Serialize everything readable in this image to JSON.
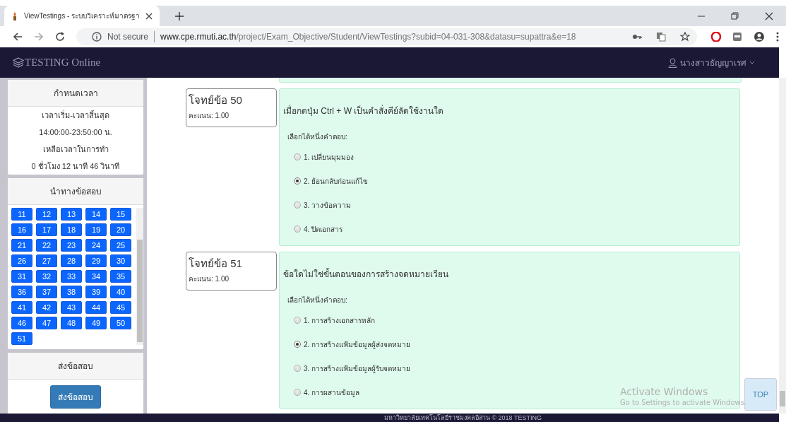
{
  "browser": {
    "tab_title": "ViewTestings - ระบบวิเคราะห์มาตรฐา",
    "security": "Not secure",
    "url_host": "www.cpe.rmuti.ac.th",
    "url_path": "/project/Exam_Objective/Student/ViewTestings?subid=04-031-308&datasu=supattra&e=18"
  },
  "navbar": {
    "brand": "TESTING Online",
    "user": "นางสาวธัญญาเรศ"
  },
  "sidebar": {
    "time_panel": {
      "title": "กำหนดเวลา",
      "lines": [
        "เวลาเริ่ม-เวลาสิ้นสุด",
        "14:00:00-23:50:00 น.",
        "เหลือเวลาในการทำ",
        "0 ชั่วโมง 12 นาที 46 วินาที"
      ]
    },
    "nav_panel": {
      "title": "นำทางข้อสอบ",
      "buttons": [
        "11",
        "12",
        "13",
        "14",
        "15",
        "16",
        "17",
        "18",
        "19",
        "20",
        "21",
        "22",
        "23",
        "24",
        "25",
        "26",
        "27",
        "28",
        "29",
        "30",
        "31",
        "32",
        "33",
        "34",
        "35",
        "36",
        "37",
        "38",
        "39",
        "40",
        "41",
        "42",
        "43",
        "44",
        "45",
        "46",
        "47",
        "48",
        "49",
        "50",
        "51"
      ]
    },
    "submit_panel": {
      "title": "ส่งข้อสอบ",
      "button": "ส่งข้อสอบ"
    }
  },
  "questions": [
    {
      "label": "โจทย์ข้อ 50",
      "score": "คะแนน: 1.00",
      "text": "เมื่อกดปุ่ม Ctrl + W เป็นคำสั่งคีย์ลัดใช้งานใด",
      "prompt": "เลือกได้หนึ่งคำตอบ:",
      "options": [
        {
          "label": "1. เปลี่ยนมุมมอง",
          "selected": false
        },
        {
          "label": "2. ย้อนกลับก่อนแก้ไข",
          "selected": true
        },
        {
          "label": "3. วางข้อความ",
          "selected": false
        },
        {
          "label": "4. ปิดเอกสาร",
          "selected": false
        }
      ]
    },
    {
      "label": "โจทย์ข้อ 51",
      "score": "คะแนน: 1.00",
      "text": "ข้อใดไม่ใช่ขั้นตอนของการสร้างจดหมายเวียน",
      "prompt": "เลือกได้หนึ่งคำตอบ:",
      "options": [
        {
          "label": "1. การสร้างเอกสารหลัก",
          "selected": false
        },
        {
          "label": "2. การสร้างแฟ้มข้อมูลผู้ส่งจดหมาย",
          "selected": true
        },
        {
          "label": "3. การสร้างแฟ้มข้อมูลผู้รับจดหมาย",
          "selected": false
        },
        {
          "label": "4. การผสานข้อมูล",
          "selected": false
        }
      ]
    }
  ],
  "top_button": "TOP",
  "os_notice": {
    "title": "Activate Windows",
    "text": "Go to Settings to activate Windows."
  },
  "footer": "มหาวิทยาลัยเทคโนโลยีราชมงคลอีสาน © 2018 TESTING"
}
